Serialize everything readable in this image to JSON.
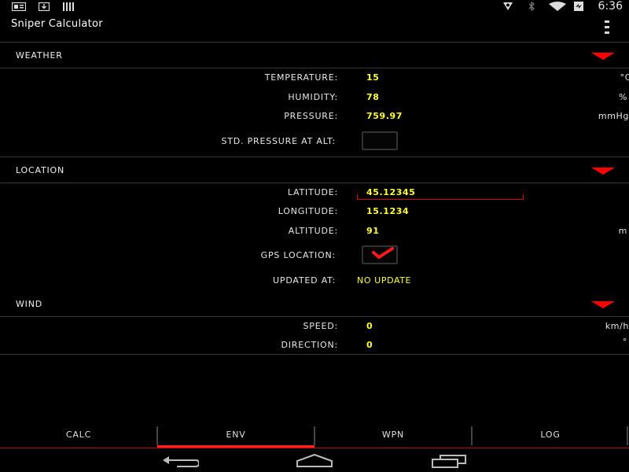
{
  "status_bar": {
    "time": "6:36"
  },
  "app": {
    "title": "Sniper Calculator"
  },
  "sections": {
    "weather": {
      "title": "WEATHER",
      "temperature": {
        "label": "TEMPERATURE:",
        "value": "15",
        "unit": "°C"
      },
      "humidity": {
        "label": "HUMIDITY:",
        "value": "78",
        "unit": "%"
      },
      "pressure": {
        "label": "PRESSURE:",
        "value": "759.97",
        "unit": "mmHg"
      },
      "std_pressure": {
        "label": "STD. PRESSURE AT ALT:",
        "checked": false
      }
    },
    "location": {
      "title": "LOCATION",
      "latitude": {
        "label": "LATITUDE:",
        "value": "45.12345"
      },
      "longitude": {
        "label": "LONGITUDE:",
        "value": "15.1234"
      },
      "altitude": {
        "label": "ALTITUDE:",
        "value": "91",
        "unit": "m"
      },
      "gps": {
        "label": "GPS LOCATION:",
        "checked": true
      },
      "updated": {
        "label": "UPDATED AT:",
        "value": "NO UPDATE"
      }
    },
    "wind": {
      "title": "WIND",
      "speed": {
        "label": "SPEED:",
        "value": "0",
        "unit": "km/h"
      },
      "direction": {
        "label": "DIRECTION:",
        "value": "0",
        "unit": "°"
      }
    }
  },
  "tabs": [
    {
      "label": "CALC"
    },
    {
      "label": "ENV",
      "selected": true
    },
    {
      "label": "WPN"
    },
    {
      "label": "LOG"
    }
  ],
  "colors": {
    "accent": "#ff0000",
    "value": "#ffff2e",
    "background": "#000000"
  },
  "icons": [
    "notification-icon",
    "download-icon",
    "barcode-icon",
    "location-icon",
    "bluetooth-icon",
    "wifi-icon",
    "battery-icon",
    "overflow-menu-icon",
    "back-icon",
    "home-icon",
    "recent-apps-icon",
    "collapse-arrow-icon",
    "checkmark-icon"
  ]
}
